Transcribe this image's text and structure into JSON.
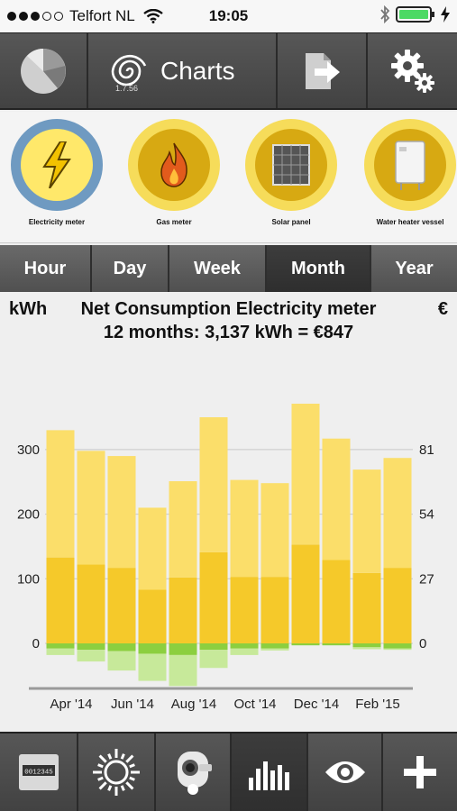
{
  "status_bar": {
    "carrier": "Telfort NL",
    "time": "19:05",
    "signal_bars_filled": 3,
    "signal_bars_total": 5,
    "battery_color": "#4cd964"
  },
  "toolbar": {
    "app_title": "Charts",
    "version": "1.7.56",
    "buttons": [
      {
        "icon": "pie-chart-icon"
      },
      {
        "icon": "swirl-logo-icon"
      },
      {
        "icon": "export-arrow-icon"
      },
      {
        "icon": "gear-icon"
      }
    ]
  },
  "meters": [
    {
      "label": "Electricity meter",
      "icon": "lightning-icon",
      "selected": true
    },
    {
      "label": "Gas meter",
      "icon": "flame-icon",
      "selected": false
    },
    {
      "label": "Solar panel",
      "icon": "solar-panel-icon",
      "selected": false
    },
    {
      "label": "Water heater vessel",
      "icon": "water-heater-icon",
      "selected": false
    }
  ],
  "periods": [
    {
      "label": "Hour",
      "selected": false
    },
    {
      "label": "Day",
      "selected": false
    },
    {
      "label": "Week",
      "selected": false
    },
    {
      "label": "Month",
      "selected": true
    },
    {
      "label": "Year",
      "selected": false
    }
  ],
  "chart_header": {
    "unit_left": "kWh",
    "unit_right": "€",
    "title": "Net Consumption Electricity meter",
    "subtitle": "12 months: 3,137 kWh = €847"
  },
  "chart_data": {
    "type": "bar",
    "stacked": true,
    "categories": [
      "Apr '14",
      "May '14",
      "Jun '14",
      "Jul '14",
      "Aug '14",
      "Sep '14",
      "Oct '14",
      "Nov '14",
      "Dec '14",
      "Jan '15",
      "Feb '15",
      "Mar '15"
    ],
    "x_tick_labels_shown": [
      "Apr '14",
      "Jun '14",
      "Aug '14",
      "Oct '14",
      "Dec '14",
      "Feb '15"
    ],
    "series": [
      {
        "values": [
          133,
          122,
          117,
          83,
          102,
          141,
          103,
          103,
          153,
          129,
          109,
          117
        ],
        "color": "#f5c92a"
      },
      {
        "values": [
          197,
          176,
          173,
          127,
          149,
          209,
          150,
          145,
          218,
          188,
          160,
          170
        ],
        "color": "#fbde6a"
      },
      {
        "values": [
          -8,
          -10,
          -12,
          -16,
          -18,
          -10,
          -8,
          -8,
          -3,
          -3,
          -6,
          -8
        ],
        "color": "#8ccf3f"
      },
      {
        "values": [
          -10,
          -18,
          -30,
          -42,
          -48,
          -28,
          -10,
          -3,
          0,
          0,
          -3,
          -2
        ],
        "color": "#c7e99a"
      }
    ],
    "ylim": [
      -70,
      380
    ],
    "y_ticks_left": [
      0,
      100,
      200,
      300
    ],
    "y_ticks_right": [
      0,
      27,
      54,
      81
    ],
    "grid": "horizontal at ticks"
  },
  "bottom_bar": {
    "buttons": [
      {
        "icon": "meter-display-icon",
        "display_text": "0012345",
        "selected": false
      },
      {
        "icon": "sun-icon",
        "selected": false
      },
      {
        "icon": "smart-plug-icon",
        "selected": false
      },
      {
        "icon": "bar-chart-icon",
        "selected": true
      },
      {
        "icon": "eye-icon",
        "selected": false
      },
      {
        "icon": "plus-icon",
        "selected": false
      }
    ]
  }
}
